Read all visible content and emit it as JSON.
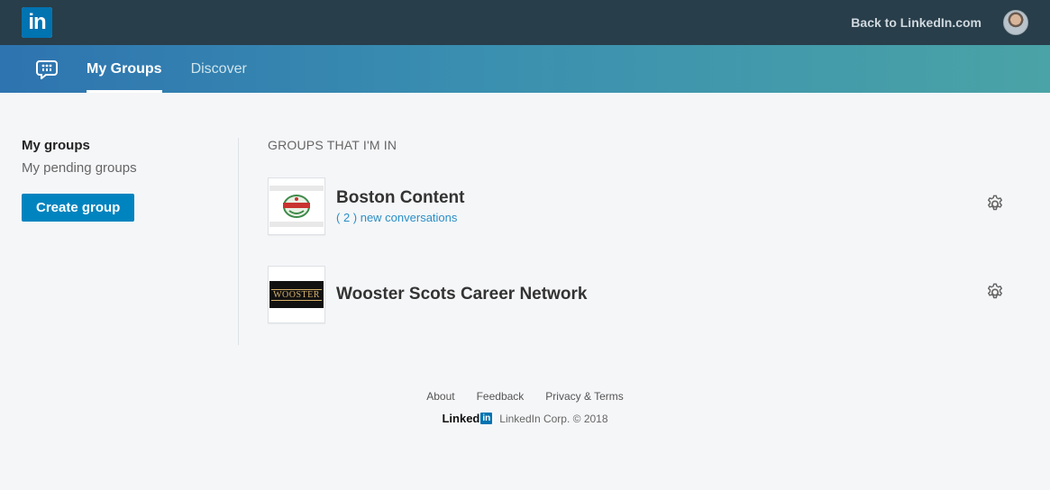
{
  "topbar": {
    "logo": "in",
    "back_link": "Back to LinkedIn.com"
  },
  "subnav": {
    "tabs": [
      {
        "label": "My Groups",
        "active": true
      },
      {
        "label": "Discover",
        "active": false
      }
    ]
  },
  "sidebar": {
    "title": "My groups",
    "pending": "My pending groups",
    "create_button": "Create group"
  },
  "content": {
    "section_title": "GROUPS THAT I'M IN",
    "groups": [
      {
        "name": "Boston Content",
        "subtitle": "( 2 ) new conversations"
      },
      {
        "name": "Wooster Scots Career Network",
        "subtitle": "",
        "logo_text": "WOOSTER"
      }
    ]
  },
  "footer": {
    "links": [
      "About",
      "Feedback",
      "Privacy & Terms"
    ],
    "brand_word": "Linked",
    "brand_in": "in",
    "copyright": "LinkedIn Corp. © 2018"
  },
  "colors": {
    "topbar": "#283e4a",
    "accent": "#0084bf",
    "link": "#2a8fc6"
  }
}
